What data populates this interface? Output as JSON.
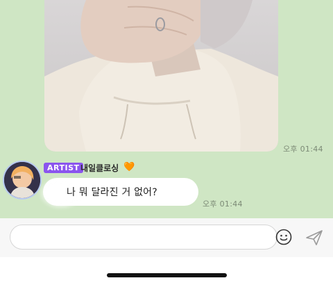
{
  "messages": {
    "photo_time": "오후 01:44",
    "text_time": "오후 01:44",
    "sender_badge": "ARTIST",
    "sender_name": "내일클로싱",
    "sender_heart": "🧡",
    "text": "나 뭐 달라진 거 없어?"
  },
  "composer": {
    "placeholder": ""
  },
  "colors": {
    "chat_background": "#cfe6c4",
    "artist_badge": "#8b55ee",
    "bubble": "#ffffff"
  },
  "icons": {
    "emoji": "smiley-icon",
    "send": "send-icon"
  }
}
